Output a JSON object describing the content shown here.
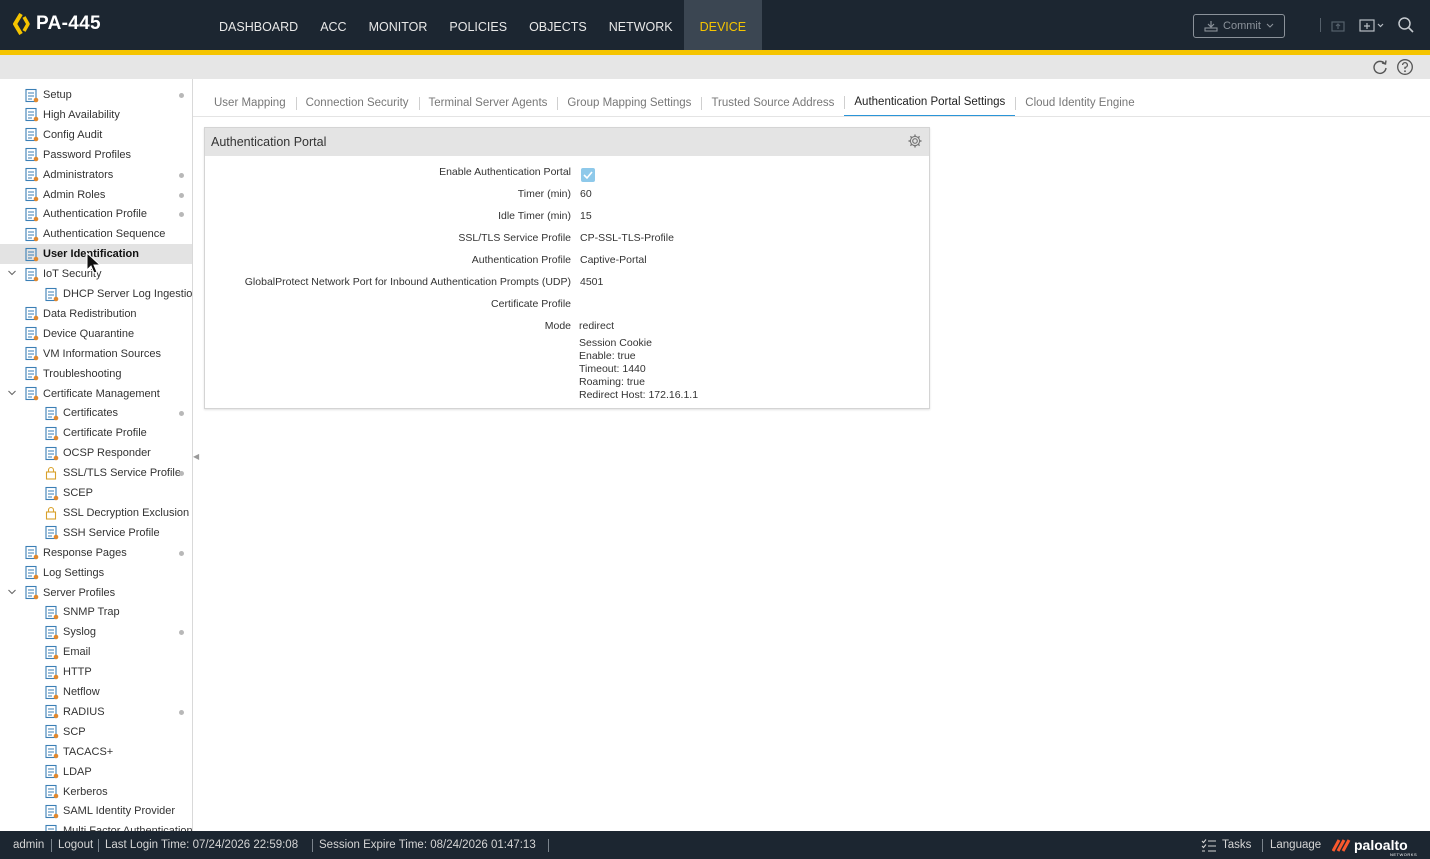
{
  "app": {
    "title": "PA-445"
  },
  "nav": {
    "items": [
      "DASHBOARD",
      "ACC",
      "MONITOR",
      "POLICIES",
      "OBJECTS",
      "NETWORK",
      "DEVICE"
    ],
    "active": "DEVICE"
  },
  "toolbar": {
    "commit_label": "Commit"
  },
  "sidebar": {
    "items": [
      {
        "label": "Setup",
        "icon": "setup-icon",
        "dot": true
      },
      {
        "label": "High Availability",
        "icon": "ha-icon",
        "dot": false
      },
      {
        "label": "Config Audit",
        "icon": "audit-icon",
        "dot": false
      },
      {
        "label": "Password Profiles",
        "icon": "password-icon",
        "dot": false
      },
      {
        "label": "Administrators",
        "icon": "admin-user-icon",
        "dot": true
      },
      {
        "label": "Admin Roles",
        "icon": "admin-roles-icon",
        "dot": true
      },
      {
        "label": "Authentication Profile",
        "icon": "auth-profile-icon",
        "dot": true
      },
      {
        "label": "Authentication Sequence",
        "icon": "auth-sequence-icon",
        "dot": false
      },
      {
        "label": "User Identification",
        "icon": "user-id-icon",
        "dot": false,
        "selected": true
      },
      {
        "label": "IoT Security",
        "icon": "iot-icon",
        "dot": false,
        "expandable": true
      },
      {
        "label": "DHCP Server Log Ingestion",
        "icon": "dhcp-icon",
        "dot": false,
        "child": true
      },
      {
        "label": "Data Redistribution",
        "icon": "data-redistribution-icon",
        "dot": false
      },
      {
        "label": "Device Quarantine",
        "icon": "quarantine-icon",
        "dot": false
      },
      {
        "label": "VM Information Sources",
        "icon": "vm-icon",
        "dot": false
      },
      {
        "label": "Troubleshooting",
        "icon": "troubleshooting-icon",
        "dot": false
      },
      {
        "label": "Certificate Management",
        "icon": "cert-mgmt-icon",
        "dot": false,
        "expandable": true
      },
      {
        "label": "Certificates",
        "icon": "certificate-icon",
        "dot": true,
        "child": true
      },
      {
        "label": "Certificate Profile",
        "icon": "certificate-icon",
        "dot": false,
        "child": true
      },
      {
        "label": "OCSP Responder",
        "icon": "certificate-icon",
        "dot": false,
        "child": true
      },
      {
        "label": "SSL/TLS Service Profile",
        "icon": "lock-icon",
        "dot": true,
        "child": true
      },
      {
        "label": "SCEP",
        "icon": "scep-icon",
        "dot": false,
        "child": true
      },
      {
        "label": "SSL Decryption Exclusion",
        "icon": "lock-icon",
        "dot": false,
        "child": true
      },
      {
        "label": "SSH Service Profile",
        "icon": "certificate-icon",
        "dot": false,
        "child": true
      },
      {
        "label": "Response Pages",
        "icon": "response-pages-icon",
        "dot": true
      },
      {
        "label": "Log Settings",
        "icon": "log-settings-icon",
        "dot": false
      },
      {
        "label": "Server Profiles",
        "icon": "server-profiles-icon",
        "dot": false,
        "expandable": true
      },
      {
        "label": "SNMP Trap",
        "icon": "server-profile-icon",
        "dot": false,
        "child": true
      },
      {
        "label": "Syslog",
        "icon": "server-profile-icon",
        "dot": true,
        "child": true
      },
      {
        "label": "Email",
        "icon": "server-profile-icon",
        "dot": false,
        "child": true
      },
      {
        "label": "HTTP",
        "icon": "http-profile-icon",
        "dot": false,
        "child": true
      },
      {
        "label": "Netflow",
        "icon": "server-profile-icon",
        "dot": false,
        "child": true
      },
      {
        "label": "RADIUS",
        "icon": "auth-server-icon",
        "dot": true,
        "child": true
      },
      {
        "label": "SCP",
        "icon": "scp-icon",
        "dot": false,
        "child": true
      },
      {
        "label": "TACACS+",
        "icon": "auth-server-icon",
        "dot": false,
        "child": true
      },
      {
        "label": "LDAP",
        "icon": "auth-server-icon",
        "dot": false,
        "child": true
      },
      {
        "label": "Kerberos",
        "icon": "auth-server-icon",
        "dot": false,
        "child": true
      },
      {
        "label": "SAML Identity Provider",
        "icon": "auth-server-icon",
        "dot": false,
        "child": true
      },
      {
        "label": "Multi Factor Authentication",
        "icon": "auth-server-icon",
        "dot": false,
        "child": true
      }
    ]
  },
  "tabs": [
    {
      "label": "User Mapping"
    },
    {
      "label": "Connection Security"
    },
    {
      "label": "Terminal Server Agents"
    },
    {
      "label": "Group Mapping Settings"
    },
    {
      "label": "Trusted Source Address"
    },
    {
      "label": "Authentication Portal Settings",
      "active": true
    },
    {
      "label": "Cloud Identity Engine"
    }
  ],
  "panel": {
    "title": "Authentication Portal",
    "fields": [
      {
        "label": "Enable Authentication Portal",
        "value": "",
        "checkbox": true,
        "checked": true
      },
      {
        "label": "Timer (min)",
        "value": "60"
      },
      {
        "label": "Idle Timer (min)",
        "value": "15"
      },
      {
        "label": "SSL/TLS Service Profile",
        "value": "CP-SSL-TLS-Profile"
      },
      {
        "label": "Authentication Profile",
        "value": "Captive-Portal"
      },
      {
        "label": "GlobalProtect Network Port for Inbound Authentication Prompts (UDP)",
        "value": "4501"
      },
      {
        "label": "Certificate Profile",
        "value": ""
      },
      {
        "label": "Mode",
        "value": "redirect"
      }
    ],
    "mode_details": [
      "Session Cookie",
      "Enable: true",
      "Timeout: 1440",
      "Roaming: true",
      "Redirect Host: 172.16.1.1"
    ]
  },
  "footer": {
    "user": "admin",
    "logout": "Logout",
    "last_login": "Last Login Time: 07/24/2026 22:59:08",
    "session_expire": "Session Expire Time: 08/24/2026 01:47:13",
    "tasks": "Tasks",
    "language": "Language",
    "brand": "paloalto",
    "brand_sub": "NETWORKS"
  },
  "colors": {
    "accent": "#f5c400",
    "topbar": "#1c2631",
    "tab_underline": "#2a95d8",
    "checkbox": "#8ec9ea",
    "brand_red": "#fa582d"
  }
}
